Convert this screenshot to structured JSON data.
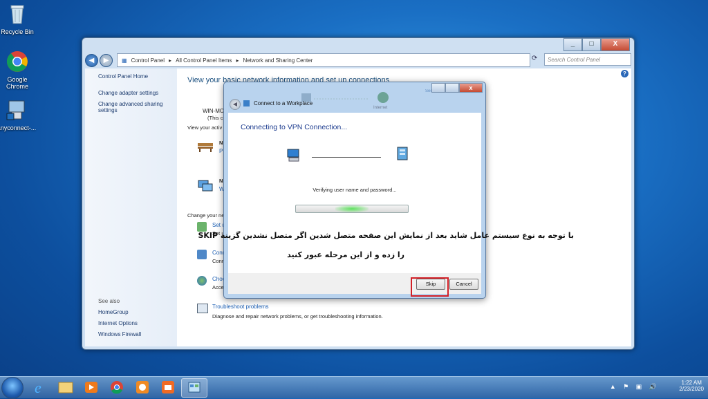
{
  "desktop": {
    "icons": [
      {
        "label": "Recycle Bin",
        "icon": "recycle-bin-icon"
      },
      {
        "label": "Google Chrome",
        "icon": "chrome-icon"
      },
      {
        "label": "anyconnect-...",
        "icon": "anyconnect-installer-icon"
      }
    ]
  },
  "window": {
    "breadcrumb": [
      "Control Panel",
      "All Control Panel Items",
      "Network and Sharing Center"
    ],
    "search_placeholder": "Search Control Panel",
    "caption": {
      "minimize": "_",
      "maximize": "□",
      "close": "X"
    },
    "left_pane": {
      "links": [
        "Control Panel Home",
        "Change adapter settings",
        "Change advanced sharing settings"
      ],
      "see_also_label": "See also",
      "see_also": [
        "HomeGroup",
        "Internet Options",
        "Windows Firewall"
      ]
    },
    "main": {
      "heading": "View your basic network information and set up connections",
      "computer_name": "WIN-MO",
      "this_computer": "(This c",
      "view_active": "View your activ",
      "net1_name": "N",
      "net1_type": "P",
      "net2_name": "N",
      "net2_type": "W",
      "change_network": "Change your ne",
      "task1_link": "Set u",
      "task1_desc": "Set u",
      "task2_link": "Conn",
      "task2_desc": "Conn",
      "task3_link": "Choo",
      "task3_desc": "Acce",
      "troubleshoot_link": "Troubleshoot problems",
      "troubleshoot_desc": "Diagnose and repair network problems, or get troubleshooting information.",
      "map_labels": [
        "Internet"
      ],
      "see_full_map": "See"
    }
  },
  "dialog": {
    "title": "Connect to a Workplace",
    "status_heading": "Connecting to VPN Connection...",
    "verify_text": "Verifying user name and password...",
    "progress_indeterminate": true,
    "skip_label": "Skip",
    "cancel_label": "Cancel"
  },
  "annotation": {
    "line1": "با توجه به نوع سیستم عامل شاید بعد از نمایش این صفحه متصل شدین اگر  متصل نشدین گزینه  SKIP",
    "line2": "را زده و از این مرحله عبور کنید",
    "highlight_color": "#d21f26"
  },
  "taskbar": {
    "apps": [
      "internet-explorer-icon",
      "file-explorer-icon",
      "media-player-icon",
      "chrome-icon",
      "app-orange-icon",
      "camera-app-icon",
      "control-panel-icon"
    ],
    "time": "1:22 AM",
    "date": "2/23/2020"
  }
}
